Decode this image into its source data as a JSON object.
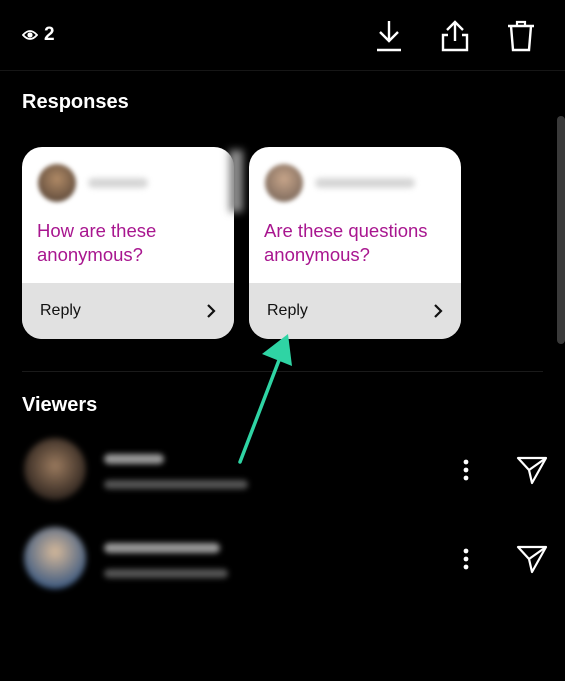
{
  "topbar": {
    "view_count": "2",
    "icons": [
      "eye-icon",
      "download-icon",
      "share-icon",
      "trash-icon"
    ]
  },
  "responses": {
    "title": "Responses",
    "cards": [
      {
        "question": "How are these anonymous?",
        "reply_label": "Reply"
      },
      {
        "question": "Are these questions anonymous?",
        "reply_label": "Reply"
      }
    ]
  },
  "viewers": {
    "title": "Viewers",
    "count": 2
  },
  "colors": {
    "background": "#000000",
    "question_text": "#a8168f",
    "reply_bar": "#e1e1e1",
    "annotation_arrow": "#2fd4a4"
  }
}
